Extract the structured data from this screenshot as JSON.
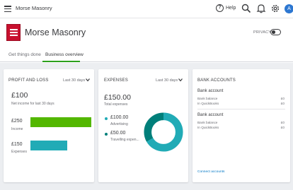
{
  "topbar": {
    "company_name": "Morse Masonry",
    "help_label": "Help",
    "help_icon": "question-circle-icon",
    "avatar_initial": "A"
  },
  "header": {
    "company_title": "Morse Masonry",
    "privacy_label": "PRIVACY",
    "privacy_on": false,
    "logo_color": "#c8102e"
  },
  "tabs": [
    {
      "label": "Get things done",
      "active": false
    },
    {
      "label": "Business overview",
      "active": true
    }
  ],
  "profit_loss": {
    "title": "PROFIT AND LOSS",
    "period": "Last 30 days",
    "net_amount": "£100",
    "net_label": "Net income for last 30 days",
    "income_amount": "£250",
    "income_label": "Income",
    "income_fraction": 1.0,
    "income_color": "#53b700",
    "expenses_amount": "£150",
    "expenses_label": "Expenses",
    "expenses_fraction": 0.6,
    "expenses_color": "#21abb6"
  },
  "expenses": {
    "title": "EXPENSES",
    "period": "Last 30 days",
    "total_amount": "£150.00",
    "total_label": "Total expenses",
    "items": [
      {
        "amount": "£100.00",
        "label": "Advertising",
        "value": 100,
        "color": "#21abb6"
      },
      {
        "amount": "£50.00",
        "label": "Travelling expen...",
        "value": 50,
        "color": "#007f7a"
      }
    ]
  },
  "bank_accounts": {
    "title": "BANK ACCOUNTS",
    "accounts": [
      {
        "name": "Bank account",
        "balance_label": "Bank balance",
        "balance_value": "£0",
        "qb_label": "In QuickBooks",
        "qb_value": "£0"
      },
      {
        "name": "Bank account",
        "balance_label": "Bank balance",
        "balance_value": "£0",
        "qb_label": "In QuickBooks",
        "qb_value": "£0"
      }
    ],
    "connect_label": "Connect accounts"
  }
}
